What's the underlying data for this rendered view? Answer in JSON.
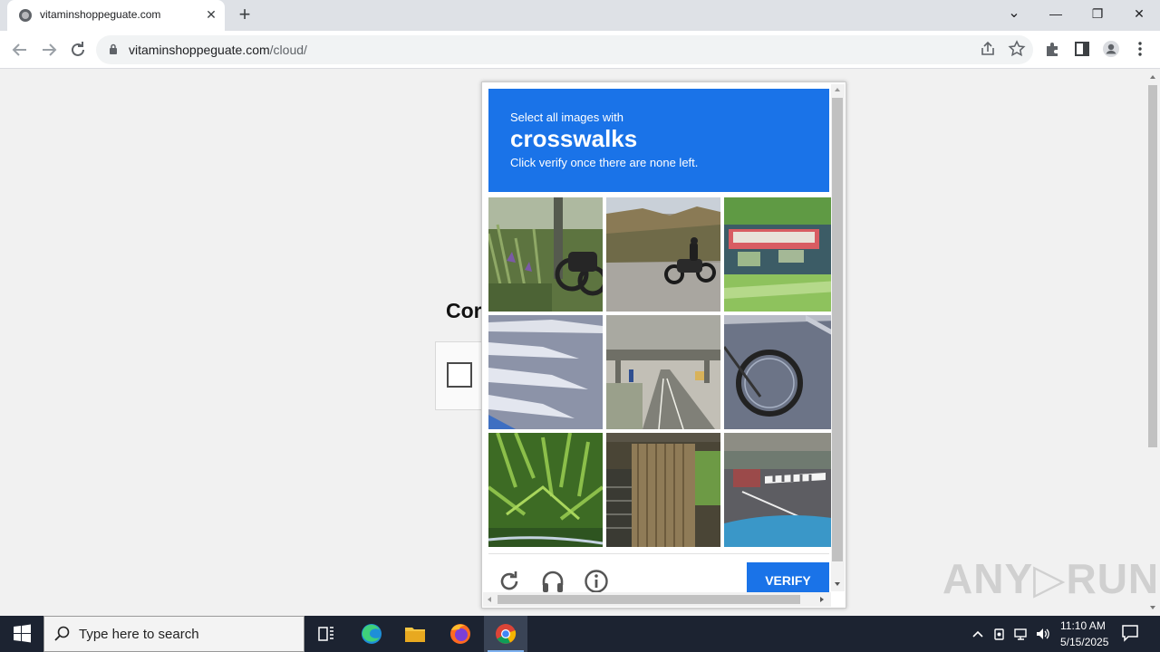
{
  "browser": {
    "tab_title": "vitaminshoppeguate.com",
    "tab_close": "✕",
    "new_tab": "+",
    "url_host": "vitaminshoppeguate.com",
    "url_path": "/cloud/",
    "window_buttons": {
      "dropdown": "⌄",
      "minimize": "—",
      "restore": "❐",
      "close": "✕"
    }
  },
  "page": {
    "heading_partial": "Cor"
  },
  "captcha": {
    "instruction": "Select all images with",
    "target": "crosswalks",
    "subtext": "Click verify once there are none left.",
    "verify_label": "VERIFY",
    "tiles": [
      "motorcycle-bushes",
      "motorcycle-road",
      "bus-trees",
      "crosswalk-stripes",
      "highway-overpass",
      "bicycle-wheel",
      "plants",
      "wooden-fence",
      "street-crosswalk"
    ]
  },
  "watermark": "ANY▷RUN",
  "taskbar": {
    "search_placeholder": "Type here to search",
    "time": "11:10 AM",
    "date": "5/15/2025"
  },
  "colors": {
    "accent": "#1a73e8",
    "taskbar": "#1c2331"
  }
}
